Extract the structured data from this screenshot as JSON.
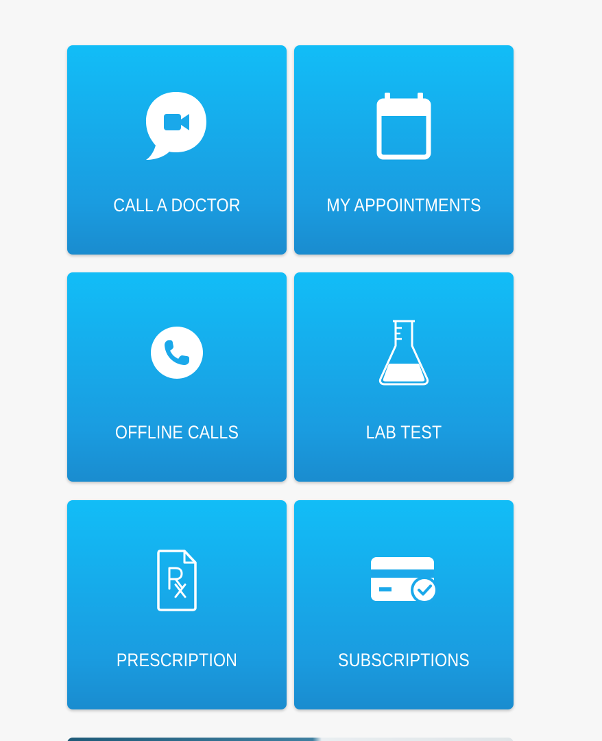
{
  "tiles": [
    {
      "label": "CALL A DOCTOR",
      "icon": "video-chat-icon"
    },
    {
      "label": "MY APPOINTMENTS",
      "icon": "calendar-icon"
    },
    {
      "label": "OFFLINE CALLS",
      "icon": "phone-icon"
    },
    {
      "label": "LAB TEST",
      "icon": "flask-icon"
    },
    {
      "label": "PRESCRIPTION",
      "icon": "prescription-icon"
    },
    {
      "label": "SUBSCRIPTIONS",
      "icon": "credit-card-check-icon"
    }
  ],
  "colors": {
    "tile_top": "#12bdf7",
    "tile_bottom": "#1a8ccf",
    "background": "#f7f7f7",
    "text": "#ffffff"
  }
}
